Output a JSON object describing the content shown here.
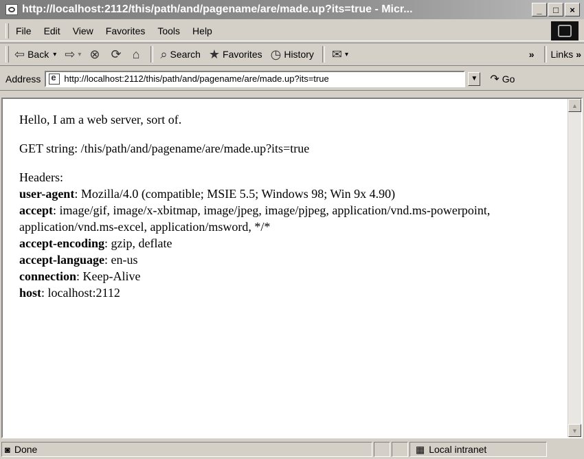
{
  "window": {
    "title": "http://localhost:2112/this/path/and/pagename/are/made.up?its=true - Micr...",
    "controls": {
      "minimize": "_",
      "maximize": "□",
      "close": "×"
    }
  },
  "menu": {
    "items": [
      "File",
      "Edit",
      "View",
      "Favorites",
      "Tools",
      "Help"
    ]
  },
  "toolbar": {
    "back": "Back",
    "search": "Search",
    "favorites": "Favorites",
    "history": "History",
    "links": "Links"
  },
  "address": {
    "label": "Address",
    "url": "http://localhost:2112/this/path/and/pagename/are/made.up?its=true",
    "go": "Go"
  },
  "page": {
    "greeting": "Hello, I am a web server, sort of.",
    "get_string": "GET string: /this/path/and/pagename/are/made.up?its=true",
    "headers_label": "Headers:",
    "headers": [
      {
        "name": "user-agent",
        "value": ": Mozilla/4.0 (compatible; MSIE 5.5; Windows 98; Win 9x 4.90)"
      },
      {
        "name": "accept",
        "value": ": image/gif, image/x-xbitmap, image/jpeg, image/pjpeg, application/vnd.ms-powerpoint, application/vnd.ms-excel, application/msword, */*"
      },
      {
        "name": "accept-encoding",
        "value": ": gzip, deflate"
      },
      {
        "name": "accept-language",
        "value": ": en-us"
      },
      {
        "name": "connection",
        "value": ": Keep-Alive"
      },
      {
        "name": "host",
        "value": ": localhost:2112"
      }
    ]
  },
  "status": {
    "text": "Done",
    "zone": "Local intranet"
  }
}
